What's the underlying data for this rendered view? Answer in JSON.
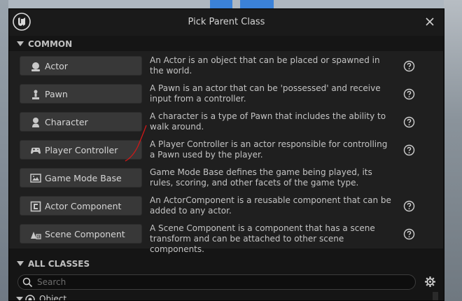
{
  "dialog": {
    "title": "Pick Parent Class"
  },
  "common": {
    "header": "COMMON",
    "items": [
      {
        "label": "Actor",
        "icon": "actor-icon",
        "description": "An Actor is an object that can be placed or spawned in the world."
      },
      {
        "label": "Pawn",
        "icon": "pawn-icon",
        "description": "A Pawn is an actor that can be 'possessed' and receive input from a controller."
      },
      {
        "label": "Character",
        "icon": "character-icon",
        "description": "A character is a type of Pawn that includes the ability to walk around."
      },
      {
        "label": "Player Controller",
        "icon": "gamepad-icon",
        "description": "A Player Controller is an actor responsible for controlling a Pawn used by the player."
      },
      {
        "label": "Game Mode Base",
        "icon": "game-mode-icon",
        "description": "Game Mode Base defines the game being played, its rules, scoring, and other facets of the game type."
      },
      {
        "label": "Actor Component",
        "icon": "actor-component-icon",
        "description": "An ActorComponent is a reusable component that can be added to any actor."
      },
      {
        "label": "Scene Component",
        "icon": "scene-component-icon",
        "description": "A Scene Component is a component that has a scene transform and can be attached to other scene components."
      }
    ]
  },
  "all_classes": {
    "header": "ALL CLASSES",
    "search_placeholder": "Search",
    "tree_root": "Object"
  },
  "colors": {
    "panel": "#1f1f1f",
    "button": "#383838",
    "background_block": "#3b82d8",
    "annotation_stroke": "#d01818"
  }
}
